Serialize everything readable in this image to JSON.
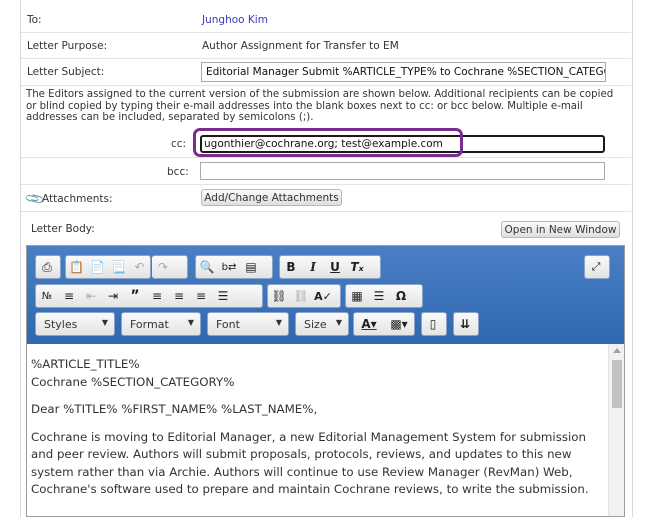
{
  "fields": {
    "to_label": "To:",
    "to_value": "Junghoo Kim",
    "purpose_label": "Letter Purpose:",
    "purpose_value": "Author Assignment for Transfer to EM",
    "subject_label": "Letter Subject:",
    "subject_value": "Editorial Manager Submit %ARTICLE_TYPE% to Cochrane %SECTION_CATEGORY%"
  },
  "recipients_note": "The Editors assigned to the current version of the submission are shown below. Additional recipients can be copied or blind copied by typing their e-mail addresses into the blank boxes next to cc: or bcc below. Multiple e-mail addresses can be included, separated by semicolons (;).",
  "cc": {
    "label": "cc:",
    "value": "ugonthier@cochrane.org; test@example.com"
  },
  "bcc": {
    "label": "bcc:",
    "value": ""
  },
  "attachments": {
    "label": "Attachments:",
    "button": "Add/Change Attachments"
  },
  "letter_body": {
    "label": "Letter Body:",
    "open_window_button": "Open in New Window"
  },
  "toolbar": {
    "styles": "Styles",
    "format": "Format",
    "font": "Font",
    "size": "Size",
    "row1_icons": [
      "print-icon",
      "paste-icon",
      "paste-text-icon",
      "paste-word-icon",
      "undo-icon",
      "redo-icon",
      "find-icon",
      "replace-icon",
      "select-all-icon",
      "bold-icon",
      "italic-icon",
      "underline-icon",
      "remove-format-icon",
      "maximize-icon"
    ],
    "row2_icons": [
      "numbered-list-icon",
      "bulleted-list-icon",
      "outdent-icon",
      "indent-icon",
      "blockquote-icon",
      "align-left-icon",
      "align-center-icon",
      "align-right-icon",
      "justify-icon",
      "link-icon",
      "unlink-icon",
      "spell-check-icon",
      "table-icon",
      "horizontal-line-icon",
      "special-char-icon"
    ]
  },
  "body": {
    "line1": "%ARTICLE_TITLE%",
    "line2": "Cochrane %SECTION_CATEGORY%",
    "greeting": "Dear %TITLE% %FIRST_NAME% %LAST_NAME%,",
    "paragraph": "Cochrane is moving to Editorial Manager, a new Editorial Management System for submission and peer review. Authors will submit proposals, protocols, reviews, and updates to this new system rather than via Archie. Authors will continue to use Review Manager (RevMan) Web, Cochrane's software used to prepare and maintain Cochrane reviews, to write the submission."
  },
  "colors": {
    "toolbar": "#3a73bb",
    "highlight": "#7b2d8e",
    "link": "#3a3ab8"
  }
}
